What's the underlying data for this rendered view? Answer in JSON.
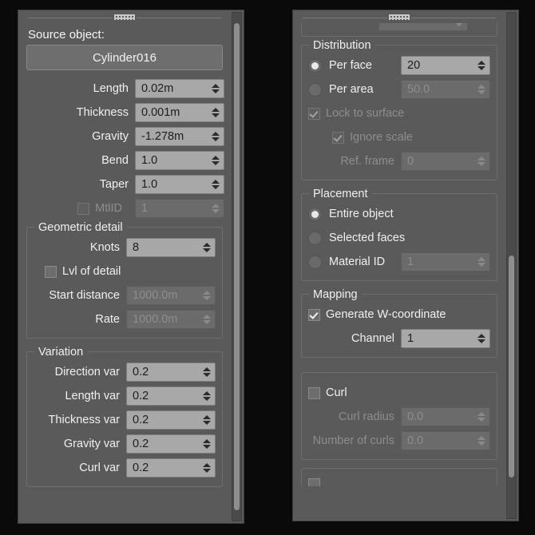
{
  "app": {
    "title": "Hair and Fur modifier parameters",
    "background_color": "#0a0a0a",
    "panel_color": "#5a5a5a",
    "field_color": "#a8a8a8",
    "text_color": "#f0f0f0",
    "disabled_text_color": "#8e8e8e"
  },
  "left_panel": {
    "name": "general-parameters-rollout",
    "source_object": {
      "label": "Source object:",
      "value": "Cylinder016"
    },
    "fields": [
      {
        "label": "Length",
        "value": "0.02m",
        "enabled": true,
        "name": "length"
      },
      {
        "label": "Thickness",
        "value": "0.001m",
        "enabled": true,
        "name": "thickness"
      },
      {
        "label": "Gravity",
        "value": "-1.278m",
        "enabled": true,
        "name": "gravity"
      },
      {
        "label": "Bend",
        "value": "1.0",
        "enabled": true,
        "name": "bend"
      },
      {
        "label": "Taper",
        "value": "1.0",
        "enabled": true,
        "name": "taper"
      }
    ],
    "mtlid": {
      "label": "MtlID",
      "value": "1",
      "checked": false,
      "enabled": false
    },
    "geometric_detail": {
      "title": "Geometric detail",
      "knots": {
        "label": "Knots",
        "value": "8",
        "enabled": true
      },
      "lvl_of_detail": {
        "label": "Lvl of detail",
        "checked": false,
        "enabled": true
      },
      "start_distance": {
        "label": "Start distance",
        "value": "1000.0m",
        "enabled": false
      },
      "rate": {
        "label": "Rate",
        "value": "1000.0m",
        "enabled": false
      }
    },
    "variation": {
      "title": "Variation",
      "fields": [
        {
          "label": "Direction var",
          "value": "0.2",
          "enabled": true
        },
        {
          "label": "Length var",
          "value": "0.2",
          "enabled": true
        },
        {
          "label": "Thickness var",
          "value": "0.2",
          "enabled": true
        },
        {
          "label": "Gravity var",
          "value": "0.2",
          "enabled": true
        },
        {
          "label": "Curl var",
          "value": "0.2",
          "enabled": true
        }
      ]
    },
    "scrollbar": {
      "thumb_top_pct": 2,
      "thumb_height_pct": 96
    }
  },
  "right_panel": {
    "name": "distribution-placement-rollout",
    "distribution": {
      "title": "Distribution",
      "per_face": {
        "label": "Per face",
        "selected": true,
        "value": "20",
        "value_enabled": true
      },
      "per_area": {
        "label": "Per area",
        "selected": false,
        "value": "50.0",
        "value_enabled": false
      },
      "lock_to_surface": {
        "label": "Lock to surface",
        "checked": true,
        "enabled": false
      },
      "ignore_scale": {
        "label": "Ignore scale",
        "checked": true,
        "enabled": false
      },
      "ref_frame": {
        "label": "Ref. frame",
        "value": "0",
        "enabled": false
      }
    },
    "placement": {
      "title": "Placement",
      "entire_object": {
        "label": "Entire object",
        "selected": true
      },
      "selected_faces": {
        "label": "Selected faces",
        "selected": false
      },
      "material_id": {
        "label": "Material ID",
        "selected": false,
        "value": "1",
        "value_enabled": false
      }
    },
    "mapping": {
      "title": "Mapping",
      "generate_w": {
        "label": "Generate W-coordinate",
        "checked": true,
        "enabled": true
      },
      "channel": {
        "label": "Channel",
        "value": "1",
        "enabled": true
      }
    },
    "curl": {
      "title": "",
      "curl": {
        "label": "Curl",
        "checked": false,
        "enabled": true
      },
      "curl_radius": {
        "label": "Curl radius",
        "value": "0.0",
        "enabled": false
      },
      "number_of_curls": {
        "label": "Number of curls",
        "value": "0.0",
        "enabled": false
      }
    },
    "scrollbar": {
      "thumb_top_pct": 48,
      "thumb_height_pct": 44
    }
  }
}
